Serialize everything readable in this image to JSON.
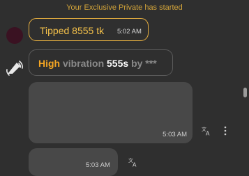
{
  "system": {
    "started": "Your Exclusive Private has started"
  },
  "tip": {
    "text": "Tipped 8555 tk",
    "time": "5:02 AM"
  },
  "vibration": {
    "level": "High",
    "word": "vibration",
    "duration": "555s",
    "by": "by",
    "user": "***"
  },
  "messages": [
    {
      "time": "5:03 AM"
    },
    {
      "time": "5:03 AM"
    }
  ],
  "icons": {
    "vibration": "vibration-icon",
    "translate": "translate-icon",
    "more": "more-vertical-icon"
  },
  "colors": {
    "accent": "#f5a623",
    "tip_border": "#e8b040",
    "background": "#2f2f2f",
    "bubble": "#484848"
  }
}
